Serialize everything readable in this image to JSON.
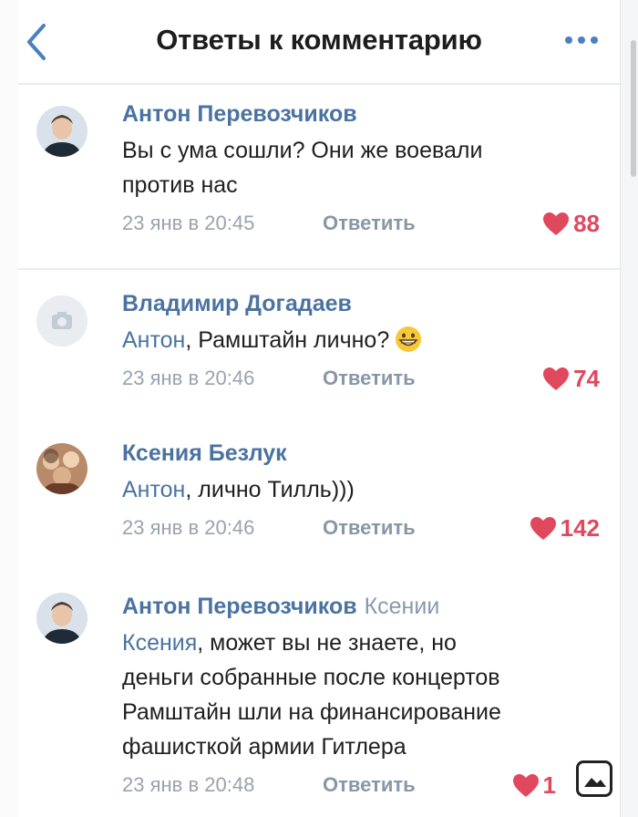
{
  "header": {
    "title": "Ответы к комментарию",
    "back_icon": "chevron-left-icon",
    "more_icon": "more-dots-icon",
    "accent": "#4a73a1"
  },
  "comments": [
    {
      "author": "Антон Перевозчиков",
      "reply_to": "",
      "mention": "",
      "text_lines": [
        "Вы с ума сошли? Они же воевали",
        "против нас"
      ],
      "time": "23 янв в 20:45",
      "reply_label": "Ответить",
      "likes": "88"
    },
    {
      "author": "Владимир Догадаев",
      "reply_to": "",
      "mention": "Антон",
      "text_lines": [
        ", Рамштайн лично?"
      ],
      "emoji": "grinning-face-emoji",
      "time": "23 янв в 20:46",
      "reply_label": "Ответить",
      "likes": "74"
    },
    {
      "author": "Ксения Безлук",
      "reply_to": "",
      "mention": "Антон",
      "text_lines": [
        ", лично Тилль)))"
      ],
      "time": "23 янв в 20:46",
      "reply_label": "Ответить",
      "likes": "142"
    },
    {
      "author": "Антон Перевозчиков",
      "reply_to": "Ксении",
      "mention": "Ксения",
      "text_lines": [
        ", может вы не знаете, но",
        "деньги собранные после концертов",
        "Рамштайн шли на финансирование",
        "фашисткой армии Гитлера"
      ],
      "time": "23 янв в 20:48",
      "reply_label": "Ответить",
      "likes": "1"
    }
  ],
  "colors": {
    "author": "#4a73a1",
    "like": "#e0485e",
    "meta": "#9aa3ad"
  }
}
